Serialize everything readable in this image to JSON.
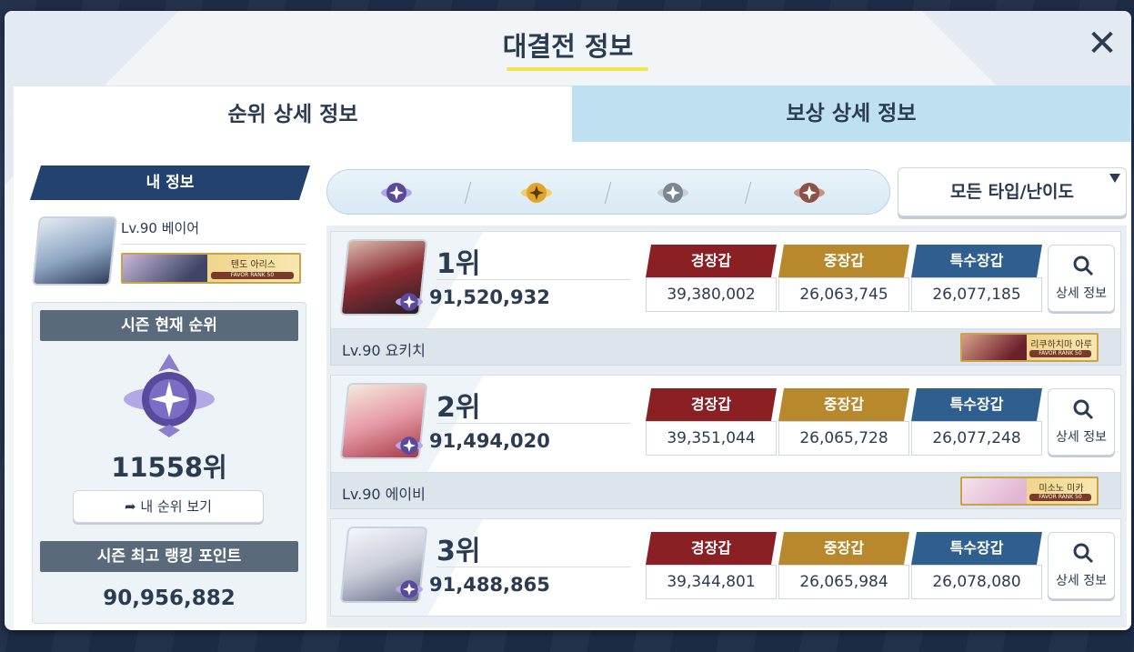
{
  "modal": {
    "title": "대결전 정보",
    "close_symbol": "✕"
  },
  "tabs": [
    {
      "label": "순위 상세 정보",
      "active": true
    },
    {
      "label": "보상 상세 정보",
      "active": false
    }
  ],
  "my_info": {
    "header": "내 정보",
    "level_name": "Lv.90 베이어",
    "badge": {
      "name": "텐도 아리스",
      "rank": "FAVOR RANK 50"
    },
    "season_rank_header": "시즌 현재 순위",
    "season_rank": "11558위",
    "view_my_rank_button": "내 순위 보기",
    "best_points_header": "시즌 최고 랭킹 포인트",
    "best_points": "90,956,882"
  },
  "filter": {
    "icons": [
      {
        "name": "platinum-emblem-icon",
        "color": "#6a5ba8"
      },
      {
        "name": "gold-emblem-icon",
        "color": "#e2a52a"
      },
      {
        "name": "silver-emblem-icon",
        "color": "#7c8592"
      },
      {
        "name": "bronze-emblem-icon",
        "color": "#8c5247"
      }
    ],
    "type_select": "모든 타입/난이도"
  },
  "armor_labels": {
    "light": "경장갑",
    "heavy": "중장갑",
    "special": "특수장갑"
  },
  "detail_label": "상세 정보",
  "ranks": [
    {
      "rank": "1위",
      "score": "91,520,932",
      "light": "39,380,002",
      "heavy": "26,063,745",
      "special": "26,077,185",
      "player": "Lv.90 요키치",
      "badge": {
        "name": "리쿠하치마 아루",
        "rank": "FAVOR RANK 50"
      }
    },
    {
      "rank": "2위",
      "score": "91,494,020",
      "light": "39,351,044",
      "heavy": "26,065,728",
      "special": "26,077,248",
      "player": "Lv.90 에이비",
      "badge": {
        "name": "미소노 미카",
        "rank": "FAVOR RANK 50"
      }
    },
    {
      "rank": "3위",
      "score": "91,488,865",
      "light": "39,344,801",
      "heavy": "26,065,984",
      "special": "26,078,080"
    }
  ],
  "colors": {
    "navy": "#23426d",
    "light_armor": "#8a1f24",
    "heavy_armor": "#b8892c",
    "special_armor": "#2f5f8e",
    "title_underline": "#f5e44c"
  }
}
